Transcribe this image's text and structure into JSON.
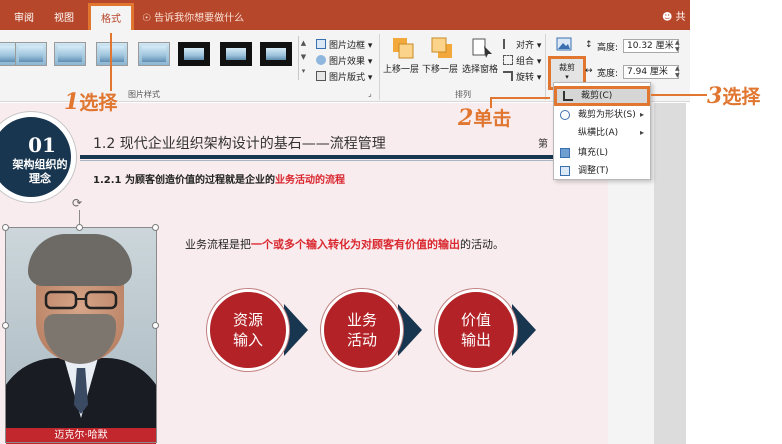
{
  "tabs": {
    "review": "审阅",
    "view": "视图",
    "format": "格式",
    "tell_me": "告诉我你想要做什么",
    "share": "共"
  },
  "picture_styles": {
    "group_label": "图片样式",
    "border": "图片边框",
    "effects": "图片效果",
    "layout": "图片版式"
  },
  "arrange": {
    "group_label": "排列",
    "bring_forward": "上移一层",
    "send_backward": "下移一层",
    "selection_pane": "选择窗格",
    "align": "对齐",
    "group": "组合",
    "rotate": "旋转"
  },
  "size": {
    "crop_label": "裁剪",
    "height_label": "高度:",
    "height_value": "10.32 厘米",
    "width_label": "宽度:",
    "width_value": "7.94 厘米"
  },
  "crop_menu": {
    "crop": "裁剪(C)",
    "crop_to_shape": "裁剪为形状(S)",
    "aspect_ratio": "纵横比(A)",
    "fill": "填充(L)",
    "fit": "调整(T)"
  },
  "slide": {
    "badge_number": "01",
    "badge_text": "架构组织的理念",
    "title": "1.2 现代企业组织架构设计的基石——流程管理",
    "page_label": "第",
    "subtitle_plain": "1.2.1 为顾客创造价值的过程就是企业的",
    "subtitle_red": "业务活动的流程",
    "body_plain_1": "业务流程是把",
    "body_red": "一个或多个输入转化为对顾客有价值的输出",
    "body_plain_2": "的活动。",
    "photo_caption": "迈克尔·哈默",
    "nodes": [
      {
        "line1": "资源",
        "line2": "输入"
      },
      {
        "line1": "业务",
        "line2": "活动"
      },
      {
        "line1": "价值",
        "line2": "输出"
      }
    ]
  },
  "callouts": {
    "c1_num": "1",
    "c1_text": "选择",
    "c2_num": "2",
    "c2_text": "单击",
    "c3_num": "3",
    "c3_text": "选择"
  },
  "colors": {
    "ribbon_red": "#b7472a",
    "callout_orange": "#e0762f",
    "navy": "#18364f",
    "accent_red": "#d9282f"
  }
}
